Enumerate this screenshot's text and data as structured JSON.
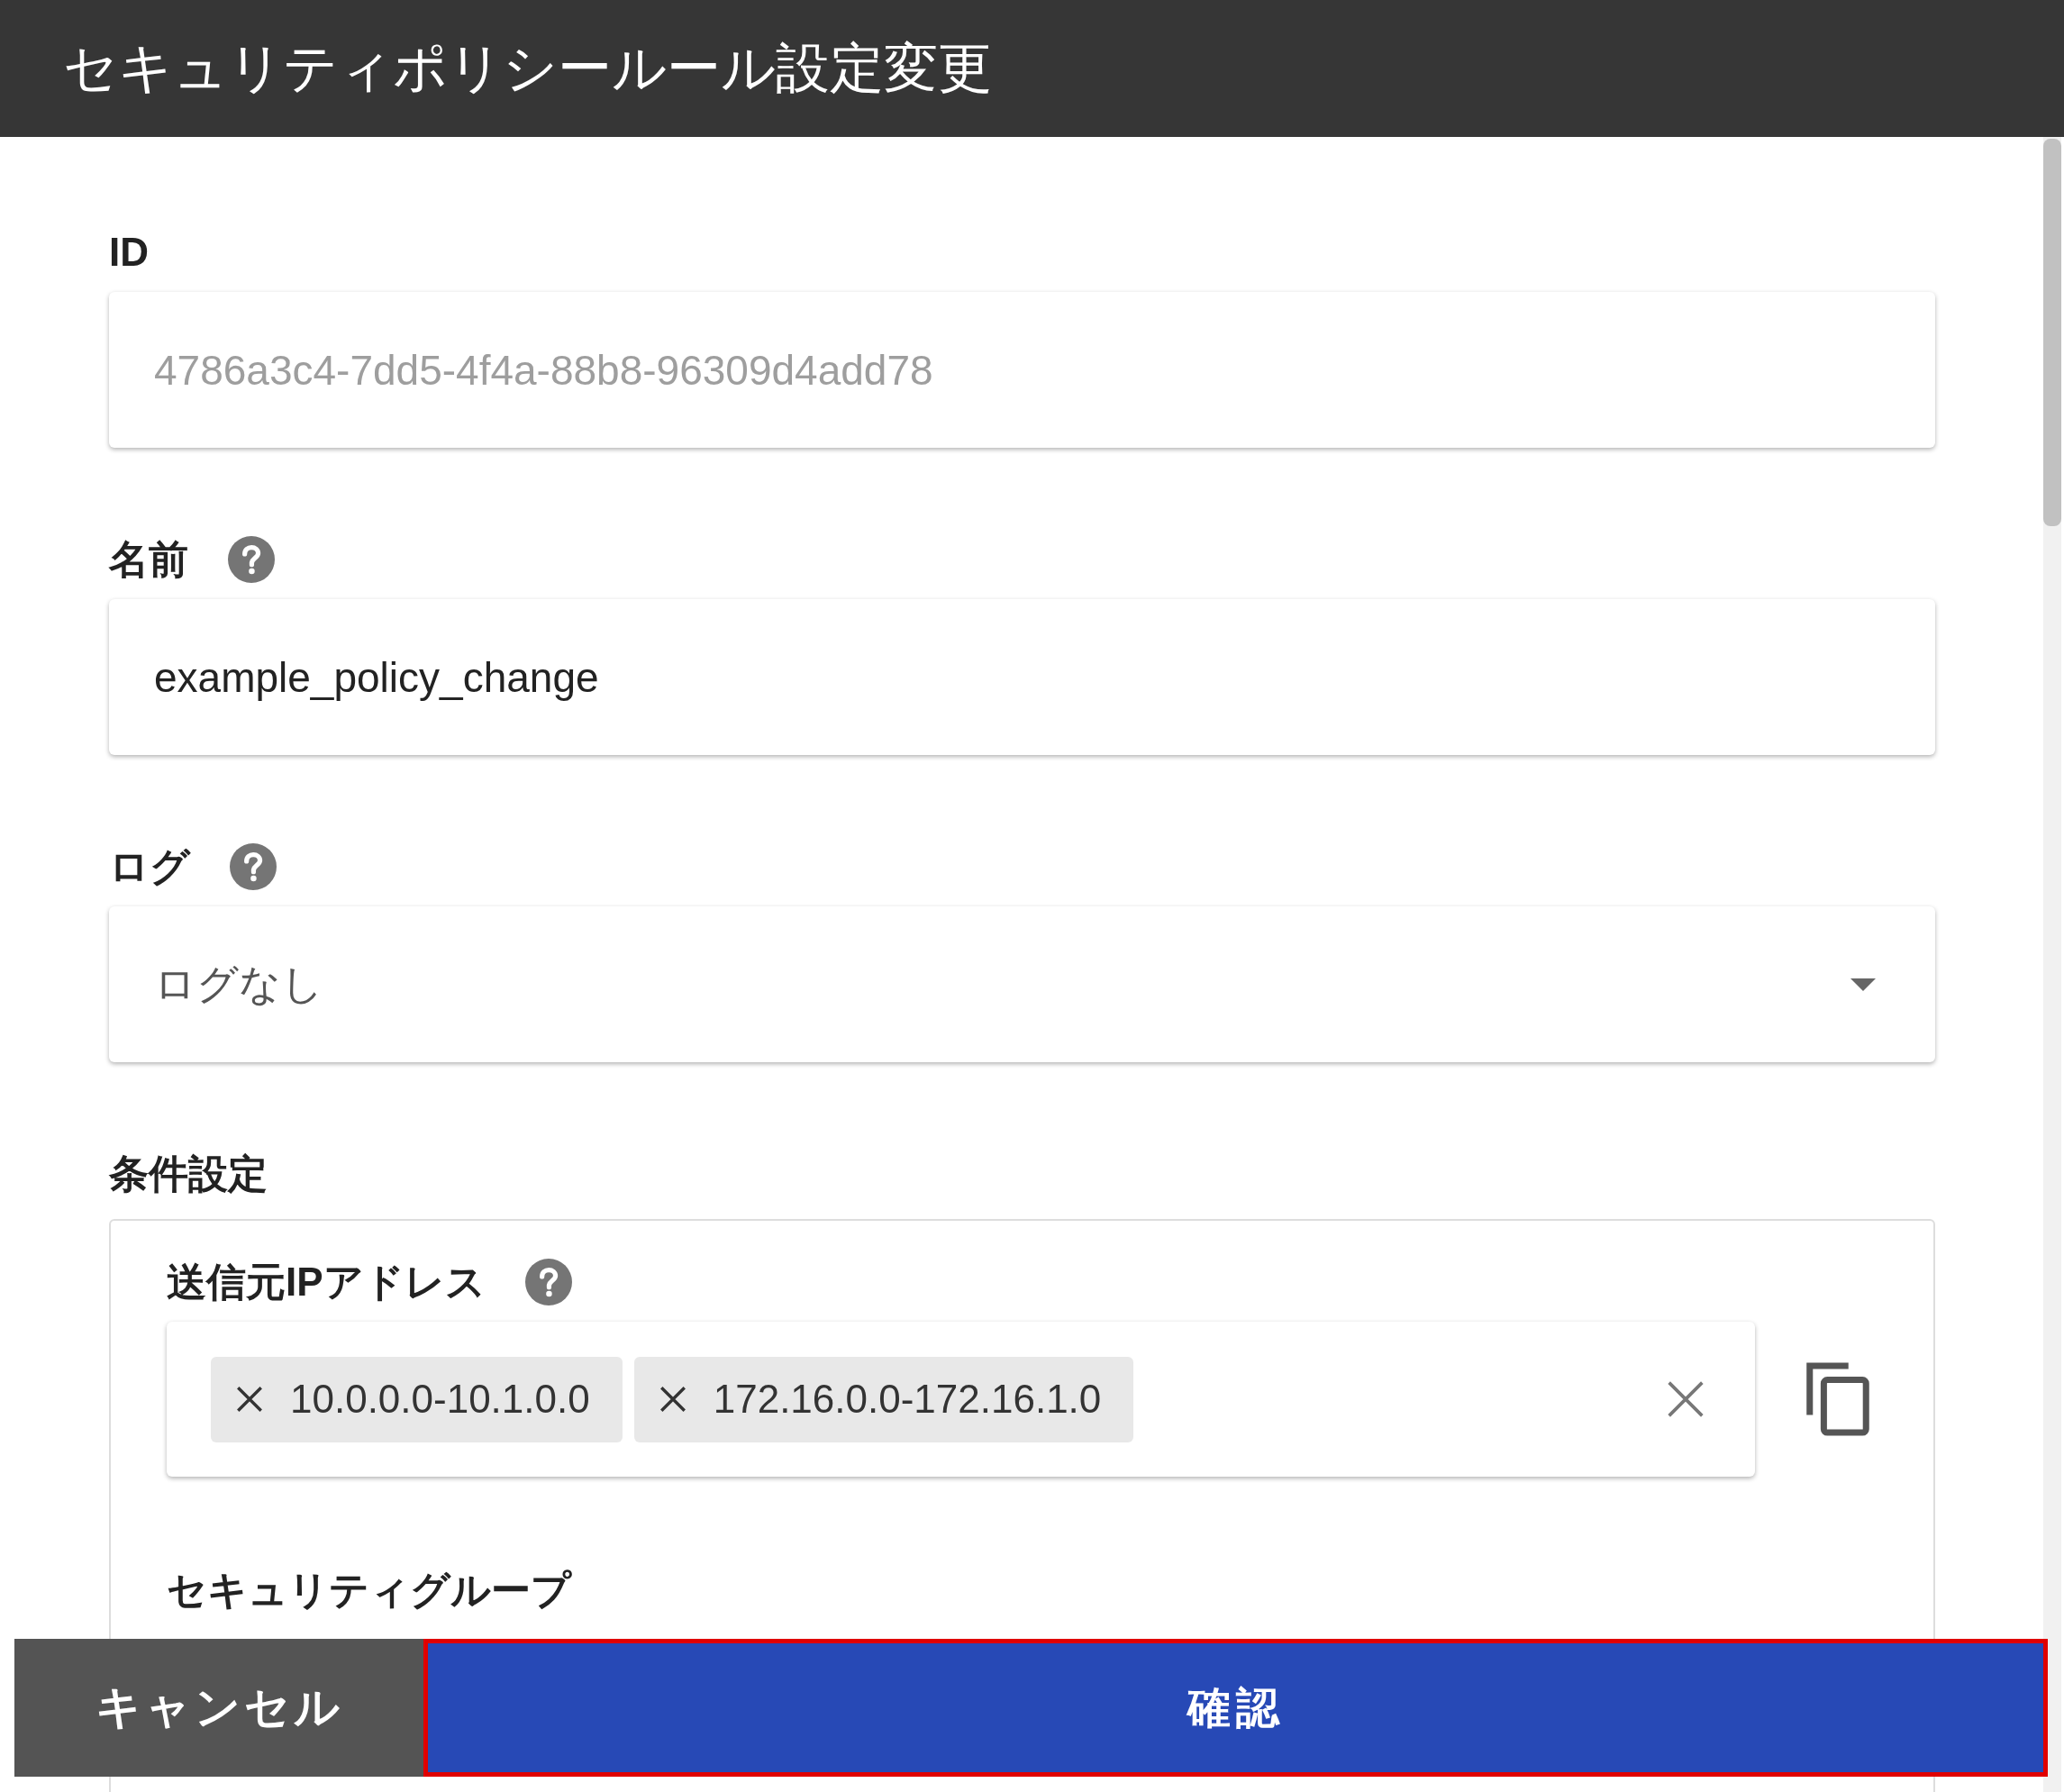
{
  "window": {
    "title": "セキュリティポリシールール設定変更"
  },
  "fields": [
    {
      "kind": "text",
      "label": "ID",
      "help": false,
      "value": "4786a3c4-7dd5-4f4a-88b8-96309d4add78",
      "disabled": true
    },
    {
      "kind": "text",
      "label": "名前",
      "help": true,
      "value": "example_policy_change",
      "disabled": false
    },
    {
      "kind": "select",
      "label": "ログ",
      "help": true,
      "value": "ログなし",
      "disabled": false
    }
  ],
  "conditions": {
    "title": "条件設定",
    "source_ip": {
      "label": "送信元IPアドレス",
      "help": true,
      "chips": [
        "10.0.0.0-10.1.0.0",
        "172.16.0.0-172.16.1.0"
      ]
    },
    "security_group": {
      "label": "セキュリティグループ"
    }
  },
  "buttons": {
    "cancel": "キャンセル",
    "confirm": "確認"
  }
}
